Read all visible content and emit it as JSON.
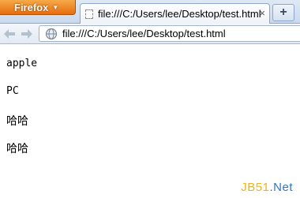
{
  "browser": {
    "menu_button": "Firefox",
    "tab": {
      "title": "file:///C:/Users/lee/Desktop/test.html",
      "close": "×"
    },
    "new_tab": "+",
    "url": "file:///C:/Users/lee/Desktop/test.html"
  },
  "page": {
    "lines": [
      "apple",
      "PC",
      "哈哈",
      "哈哈"
    ]
  },
  "watermark": {
    "part1": "JB51",
    "part2": ".Net"
  },
  "colors": {
    "firefox_orange": "#e66d0f",
    "watermark_yellow": "#e7b422",
    "watermark_blue": "#2f78c4"
  }
}
